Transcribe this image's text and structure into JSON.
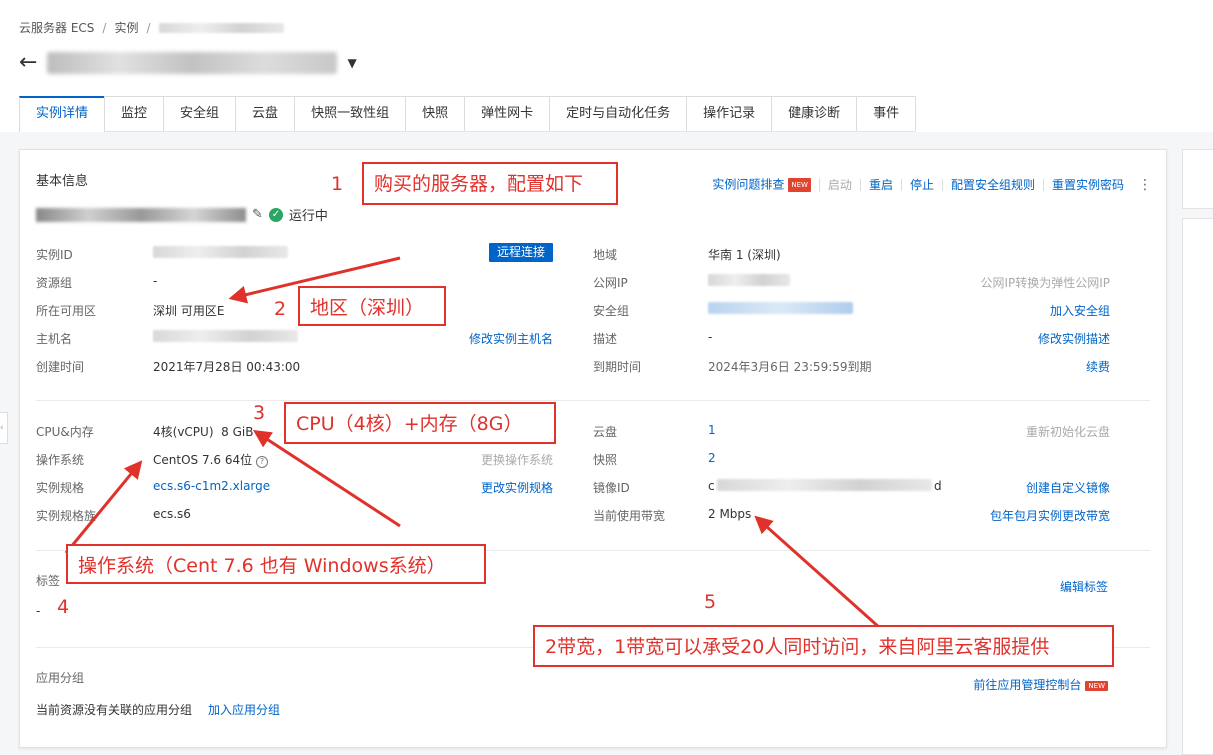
{
  "breadcrumb": {
    "items": [
      "云服务器 ECS",
      "实例"
    ],
    "sep": "/"
  },
  "header": {
    "back_icon": "back-arrow-icon",
    "dropdown_icon": "caret-down-icon"
  },
  "tabs": [
    "实例详情",
    "监控",
    "安全组",
    "云盘",
    "快照一致性组",
    "快照",
    "弹性网卡",
    "定时与自动化任务",
    "操作记录",
    "健康诊断",
    "事件"
  ],
  "basic": {
    "title": "基本信息",
    "status": "运行中",
    "actions": {
      "troubleshoot": "实例问题排查",
      "new_badge": "NEW",
      "start": "启动",
      "restart": "重启",
      "stop": "停止",
      "sg_rules": "配置安全组规则",
      "reset_pwd": "重置实例密码"
    }
  },
  "fields": {
    "instance_id": {
      "label": "实例ID",
      "action": "远程连接"
    },
    "resource_group": {
      "label": "资源组",
      "value": "-"
    },
    "zone": {
      "label": "所在可用区",
      "value": "深圳 可用区E"
    },
    "hostname": {
      "label": "主机名",
      "action": "修改实例主机名"
    },
    "created": {
      "label": "创建时间",
      "value": "2021年7月28日 00:43:00"
    },
    "region": {
      "label": "地域",
      "value": "华南 1 (深圳)"
    },
    "public_ip": {
      "label": "公网IP",
      "action": "公网IP转换为弹性公网IP"
    },
    "security_group": {
      "label": "安全组",
      "action": "加入安全组"
    },
    "desc": {
      "label": "描述",
      "value": "-",
      "action": "修改实例描述"
    },
    "expire": {
      "label": "到期时间",
      "value": "2024年3月6日 23:59:59到期",
      "action": "续费"
    },
    "cpu_mem": {
      "label": "CPU&内存",
      "value": "4核(vCPU)  8 GiB"
    },
    "os": {
      "label": "操作系统",
      "value": "CentOS 7.6 64位",
      "action": "更换操作系统"
    },
    "spec": {
      "label": "实例规格",
      "value": "ecs.s6-c1m2.xlarge",
      "action": "更改实例规格"
    },
    "spec_family": {
      "label": "实例规格族",
      "value": "ecs.s6"
    },
    "disk": {
      "label": "云盘",
      "value": "1",
      "action": "重新初始化云盘"
    },
    "snapshot": {
      "label": "快照",
      "value": "2"
    },
    "image_id": {
      "label": "镜像ID",
      "value": "c",
      "value_end": "d",
      "action": "创建自定义镜像"
    },
    "bandwidth": {
      "label": "当前使用带宽",
      "value": "2 Mbps",
      "action": "包年包月实例更改带宽"
    }
  },
  "tags": {
    "label": "标签",
    "value": "-",
    "action": "编辑标签"
  },
  "app_group": {
    "label": "应用分组",
    "empty_text": "当前资源没有关联的应用分组",
    "join": "加入应用分组",
    "console": "前往应用管理控制台",
    "new_badge": "NEW"
  },
  "annotations": [
    {
      "num": "1",
      "text": "购买的服务器，配置如下"
    },
    {
      "num": "2",
      "text": "地区（深圳）"
    },
    {
      "num": "3",
      "text": "CPU（4核）+内存（8G）"
    },
    {
      "num": "4",
      "text": "操作系统（Cent 7.6  也有 Windows系统）"
    },
    {
      "num": "5",
      "text": "2带宽，1带宽可以承受20人同时访问，来自阿里云客服提供"
    }
  ],
  "colors": {
    "link": "#0064c8",
    "annotation": "#e0312b",
    "status_ok": "#2aa564"
  }
}
